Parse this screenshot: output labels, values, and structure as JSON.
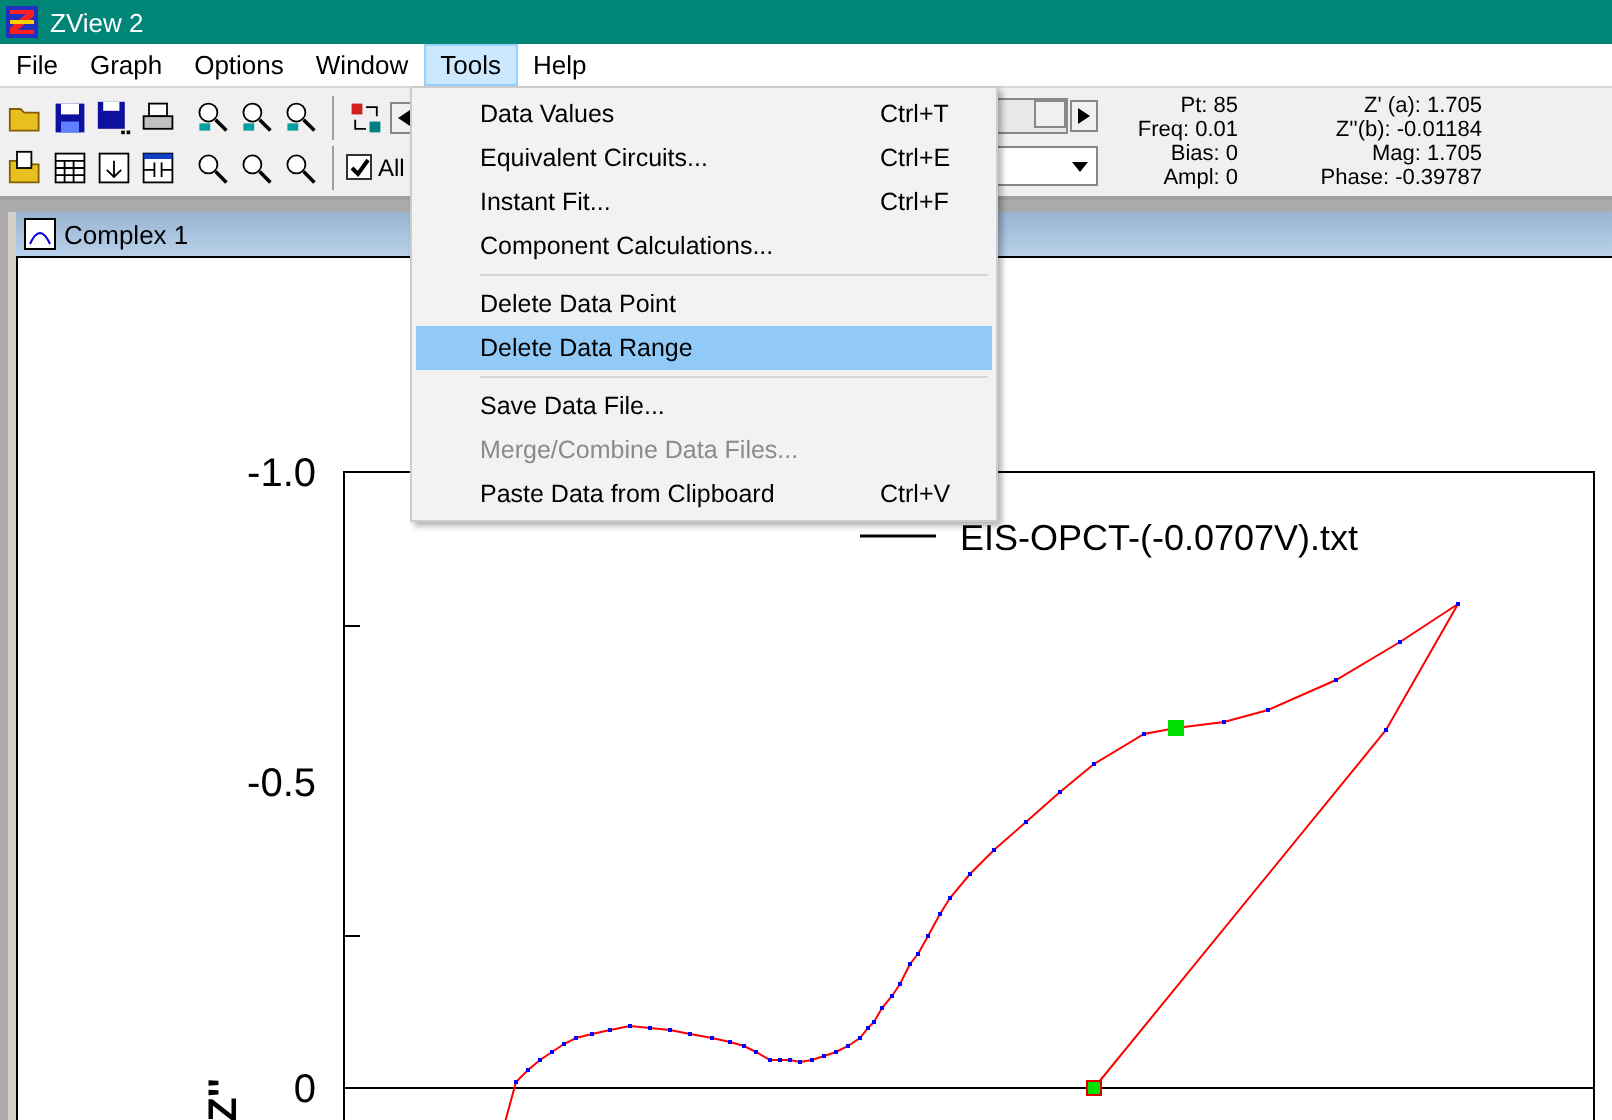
{
  "window": {
    "title": "ZView 2"
  },
  "menu": [
    {
      "label": "File",
      "selected": false
    },
    {
      "label": "Graph",
      "selected": false
    },
    {
      "label": "Options",
      "selected": false
    },
    {
      "label": "Window",
      "selected": false
    },
    {
      "label": "Tools",
      "selected": true
    },
    {
      "label": "Help",
      "selected": false
    }
  ],
  "toolbar": {
    "all_checkbox": {
      "label": "All",
      "checked": true
    },
    "slider": {
      "level": 1
    },
    "readouts_left": [
      "Pt: 85",
      "Freq: 0.01",
      "Bias: 0",
      "Ampl: 0"
    ],
    "readouts_right": [
      "Z' (a): 1.705",
      "Z''(b): -0.01184",
      "Mag: 1.705",
      "Phase: -0.39787"
    ]
  },
  "tools_menu": {
    "groups": [
      [
        {
          "label": "Data Values",
          "shortcut": "Ctrl+T",
          "selected": false,
          "disabled": false
        },
        {
          "label": "Equivalent Circuits...",
          "shortcut": "Ctrl+E",
          "selected": false,
          "disabled": false
        },
        {
          "label": "Instant Fit...",
          "shortcut": "Ctrl+F",
          "selected": false,
          "disabled": false
        },
        {
          "label": "Component Calculations...",
          "selected": false,
          "disabled": false
        }
      ],
      [
        {
          "label": "Delete Data Point",
          "selected": false,
          "disabled": false
        },
        {
          "label": "Delete Data Range",
          "selected": true,
          "disabled": false
        }
      ],
      [
        {
          "label": "Save Data File...",
          "selected": false,
          "disabled": false
        },
        {
          "label": "Merge/Combine Data Files...",
          "selected": false,
          "disabled": true
        },
        {
          "label": "Paste Data from Clipboard",
          "shortcut": "Ctrl+V",
          "selected": false,
          "disabled": false
        }
      ]
    ]
  },
  "graph_window": {
    "title": "Complex 1",
    "legend": "EIS-OPCT-(-0.0707V).txt",
    "y_ticks": [
      "-1.0",
      "-0.5",
      "0"
    ],
    "y_label": "Z''"
  }
}
